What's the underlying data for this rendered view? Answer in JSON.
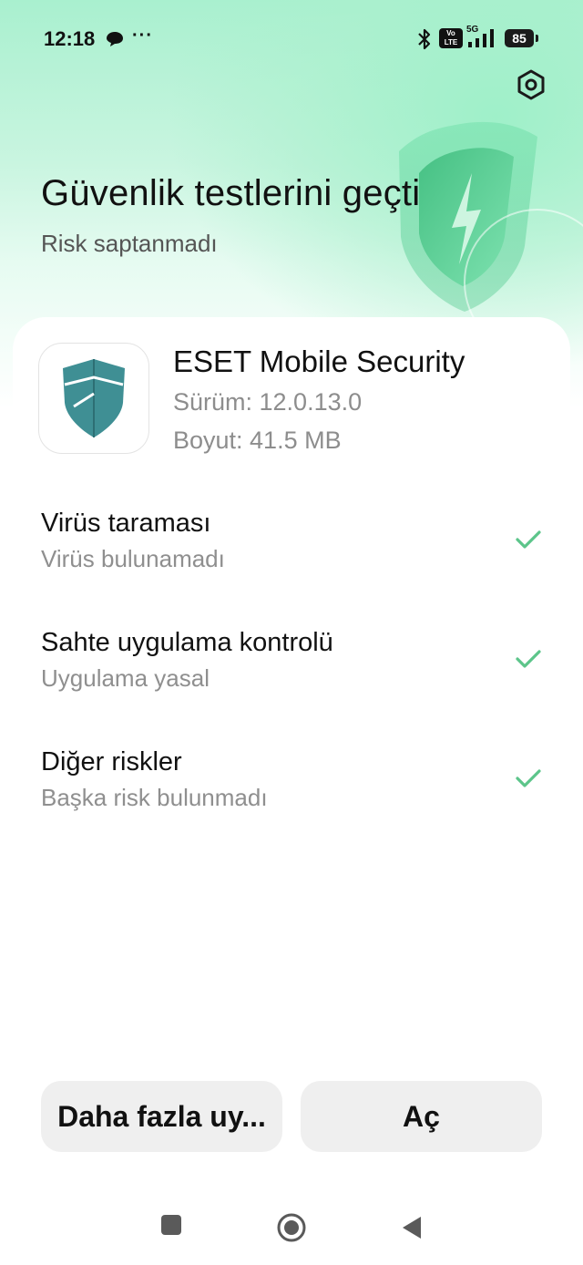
{
  "status_bar": {
    "time": "12:18",
    "more_dots": "···",
    "battery": "85",
    "network_label": "5G",
    "volte_label": "Vo LTE",
    "icons": [
      "chat-bubble-icon",
      "bluetooth-icon",
      "volte-icon",
      "signal-icon",
      "battery-icon"
    ]
  },
  "header": {
    "title": "Güvenlik testlerini geçti",
    "subtitle": "Risk saptanmadı",
    "settings_icon": "gear-icon"
  },
  "app": {
    "name": "ESET Mobile Security",
    "version": "Sürüm: 12.0.13.0",
    "size": "Boyut: 41.5 MB",
    "icon": "eset-shield-icon"
  },
  "checks": [
    {
      "title": "Virüs taraması",
      "subtitle": "Virüs bulunamadı",
      "status": "passed"
    },
    {
      "title": "Sahte uygulama kontrolü",
      "subtitle": "Uygulama yasal",
      "status": "passed"
    },
    {
      "title": "Diğer riskler",
      "subtitle": "Başka risk bulunmadı",
      "status": "passed"
    }
  ],
  "actions": {
    "more_label": "Daha fazla uy...",
    "open_label": "Aç"
  },
  "nav": {
    "icons": [
      "recents-square-icon",
      "home-circle-icon",
      "back-triangle-icon"
    ]
  },
  "colors": {
    "accent_green": "#5cc58a",
    "hero_mint": "#a9f0cf",
    "button_gray": "#efefef",
    "eset_teal": "#3f8f94"
  }
}
